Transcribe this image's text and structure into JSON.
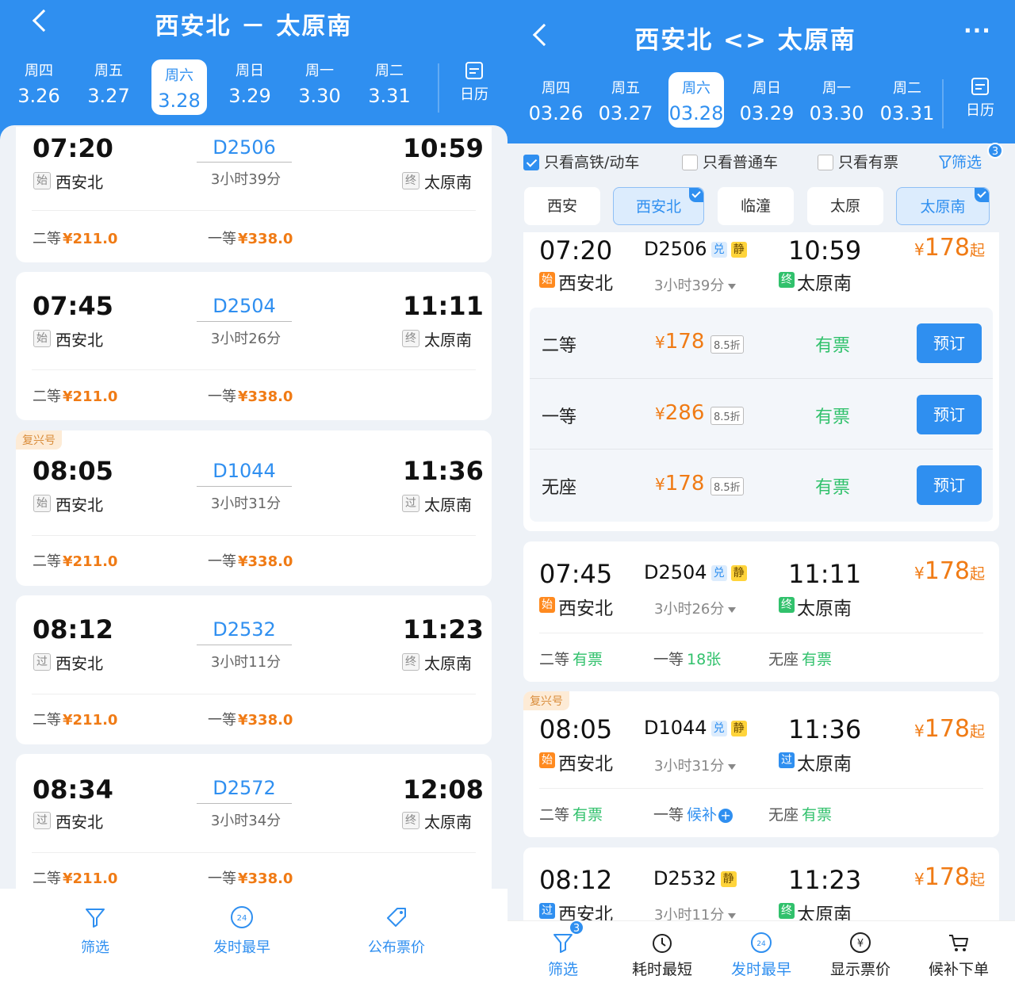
{
  "left": {
    "title": "西安北 － 太原南",
    "days": [
      {
        "week": "周四",
        "date": "3.26"
      },
      {
        "week": "周五",
        "date": "3.27"
      },
      {
        "week": "周六",
        "date": "3.28"
      },
      {
        "week": "周日",
        "date": "3.29"
      },
      {
        "week": "周一",
        "date": "3.30"
      },
      {
        "week": "周二",
        "date": "3.31"
      }
    ],
    "calendar": "日历",
    "trains": [
      {
        "dep": "07:20",
        "arr": "10:59",
        "no": "D2506",
        "dur": "3小时39分",
        "from_tag": "始",
        "from": "西安北",
        "to_tag": "终",
        "to": "太原南",
        "c2_label": "二等",
        "c2": "¥211.0",
        "c1_label": "一等",
        "c1": "¥338.0",
        "badge": ""
      },
      {
        "dep": "07:45",
        "arr": "11:11",
        "no": "D2504",
        "dur": "3小时26分",
        "from_tag": "始",
        "from": "西安北",
        "to_tag": "终",
        "to": "太原南",
        "c2_label": "二等",
        "c2": "¥211.0",
        "c1_label": "一等",
        "c1": "¥338.0",
        "badge": ""
      },
      {
        "dep": "08:05",
        "arr": "11:36",
        "no": "D1044",
        "dur": "3小时31分",
        "from_tag": "始",
        "from": "西安北",
        "to_tag": "过",
        "to": "太原南",
        "c2_label": "二等",
        "c2": "¥211.0",
        "c1_label": "一等",
        "c1": "¥338.0",
        "badge": "复兴号"
      },
      {
        "dep": "08:12",
        "arr": "11:23",
        "no": "D2532",
        "dur": "3小时11分",
        "from_tag": "过",
        "from": "西安北",
        "to_tag": "终",
        "to": "太原南",
        "c2_label": "二等",
        "c2": "¥211.0",
        "c1_label": "一等",
        "c1": "¥338.0",
        "badge": ""
      },
      {
        "dep": "08:34",
        "arr": "12:08",
        "no": "D2572",
        "dur": "3小时34分",
        "from_tag": "过",
        "from": "西安北",
        "to_tag": "终",
        "to": "太原南",
        "c2_label": "二等",
        "c2": "¥211.0",
        "c1_label": "一等",
        "c1": "¥338.0",
        "badge": ""
      }
    ],
    "bottom": [
      "筛选",
      "发时最早",
      "公布票价"
    ],
    "icon24": "24"
  },
  "right": {
    "title": "西安北 <> 太原南",
    "more": "···",
    "days": [
      {
        "week": "周四",
        "date": "03.26"
      },
      {
        "week": "周五",
        "date": "03.27"
      },
      {
        "week": "周六",
        "date": "03.28"
      },
      {
        "week": "周日",
        "date": "03.29"
      },
      {
        "week": "周一",
        "date": "03.30"
      },
      {
        "week": "周二",
        "date": "03.31"
      }
    ],
    "calendar": "日历",
    "checks": [
      "只看高铁/动车",
      "只看普通车",
      "只看有票"
    ],
    "filter": "筛选",
    "filter_count": "3",
    "stations": [
      "西安",
      "西安北",
      "临潼",
      "太原",
      "太原南"
    ],
    "first": {
      "dep": "07:20",
      "arr": "10:59",
      "no": "D2506",
      "tag1": "兑",
      "tag2": "静",
      "dur": "3小时39分",
      "from_tag": "始",
      "from": "西安北",
      "to_tag": "终",
      "to": "太原南",
      "price": "178",
      "yen": "¥",
      "qi": "起",
      "seats": [
        {
          "name": "二等",
          "price": "178",
          "disc": "8.5折",
          "avail": "有票",
          "btn": "预订"
        },
        {
          "name": "一等",
          "price": "286",
          "disc": "8.5折",
          "avail": "有票",
          "btn": "预订"
        },
        {
          "name": "无座",
          "price": "178",
          "disc": "8.5折",
          "avail": "有票",
          "btn": "预订"
        }
      ]
    },
    "trains": [
      {
        "dep": "07:45",
        "arr": "11:11",
        "no": "D2504",
        "tag1": "兑",
        "tag2": "静",
        "dur": "3小时26分",
        "from_tag": "始",
        "from": "西安北",
        "to_tag": "终",
        "to": "太原南",
        "price": "178",
        "badge": "",
        "avail": [
          {
            "label": "二等",
            "val": "有票"
          },
          {
            "label": "一等",
            "val": "18张"
          },
          {
            "label": "无座",
            "val": "有票"
          }
        ]
      },
      {
        "dep": "08:05",
        "arr": "11:36",
        "no": "D1044",
        "tag1": "兑",
        "tag2": "静",
        "dur": "3小时31分",
        "from_tag": "始",
        "from": "西安北",
        "to_tag": "过",
        "to": "太原南",
        "price": "178",
        "badge": "复兴号",
        "avail": [
          {
            "label": "二等",
            "val": "有票"
          },
          {
            "label": "一等",
            "val": "候补"
          },
          {
            "label": "无座",
            "val": "有票"
          }
        ]
      },
      {
        "dep": "08:12",
        "arr": "11:23",
        "no": "D2532",
        "tag1": "",
        "tag2": "静",
        "dur": "3小时11分",
        "from_tag": "过",
        "from": "西安北",
        "to_tag": "终",
        "to": "太原南",
        "price": "178",
        "badge": "",
        "avail": []
      }
    ],
    "yen": "¥",
    "qi": "起",
    "bottom": [
      "筛选",
      "耗时最短",
      "发时最早",
      "显示票价",
      "候补下单"
    ],
    "bottom_badge": "3",
    "icon24": "24",
    "icon_yen": "¥",
    "plus": "+"
  }
}
